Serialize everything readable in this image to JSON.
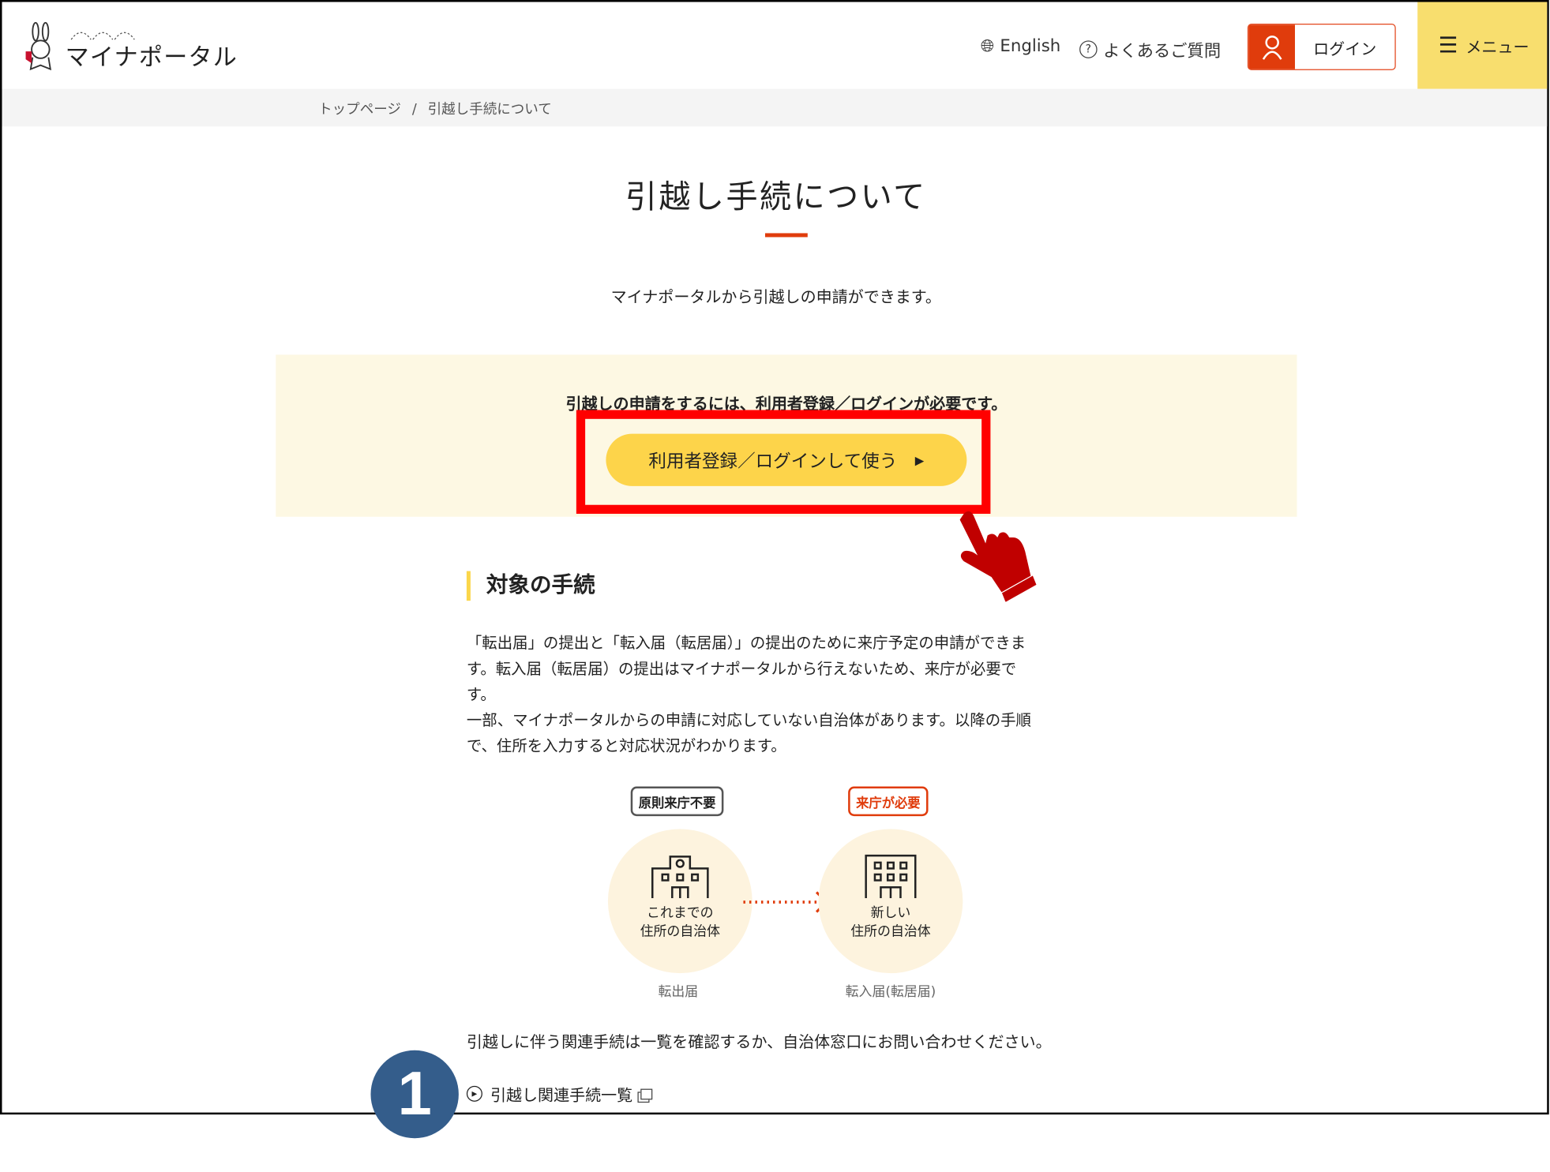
{
  "header": {
    "logo_text": "マイナポータル",
    "english_label": "English",
    "faq_label": "よくあるご質問",
    "login_label": "ログイン",
    "menu_label": "メニュー"
  },
  "breadcrumb": {
    "home": "トップページ",
    "separator": "/",
    "current": "引越し手続について"
  },
  "main": {
    "title": "引越し手続について",
    "subtitle": "マイナポータルから引越しの申請ができます。",
    "notice_text": "引越しの申請をするには、利用者登録／ログインが必要です。",
    "cta_label": "利用者登録／ログインして使う",
    "section_title": "対象の手続",
    "paragraph_lines": [
      "「転出届」の提出と「転入届（転居届）」の提出のために来庁予定の申請ができま",
      "す。転入届（転居届）の提出はマイナポータルから行えないため、来庁が必要で",
      "す。",
      "一部、マイナポータルからの申請に対応していない自治体があります。以降の手順",
      "で、住所を入力すると対応状況がわかります。"
    ],
    "diagram": {
      "left_badge": "原則来庁不要",
      "left_label_1": "これまでの",
      "left_label_2": "住所の自治体",
      "left_caption": "転出届",
      "right_badge": "来庁が必要",
      "right_label_1": "新しい",
      "right_label_2": "住所の自治体",
      "right_caption": "転入届(転居届)"
    },
    "bottom_text": "引越しに伴う関連手続は一覧を確認するか、自治体窓口にお問い合わせください。",
    "related_link": "引越し関連手続一覧"
  },
  "annotation": {
    "step_number": "1",
    "highlight_color": "#ff0000",
    "step_color": "#345d8b"
  },
  "colors": {
    "accent": "#e03c0c",
    "yellow": "#fdd44a",
    "notice_bg": "#fdf8e3"
  }
}
